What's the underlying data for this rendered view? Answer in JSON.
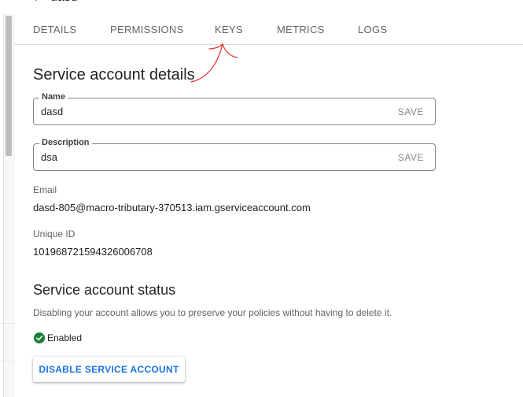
{
  "header": {
    "title": "dasd"
  },
  "tabs": [
    {
      "label": "DETAILS"
    },
    {
      "label": "PERMISSIONS"
    },
    {
      "label": "KEYS"
    },
    {
      "label": "METRICS"
    },
    {
      "label": "LOGS"
    }
  ],
  "details": {
    "heading": "Service account details",
    "name": {
      "label": "Name",
      "value": "dasd",
      "save_label": "SAVE"
    },
    "description": {
      "label": "Description",
      "value": "dsa",
      "save_label": "SAVE"
    },
    "email": {
      "label": "Email",
      "value": "dasd-805@macro-tributary-370513.iam.gserviceaccount.com"
    },
    "unique_id": {
      "label": "Unique ID",
      "value": "101968721594326006708"
    }
  },
  "status": {
    "heading": "Service account status",
    "description": "Disabling your account allows you to preserve your policies without having to delete it.",
    "state_label": "Enabled",
    "state_color": "#188038",
    "disable_button_label": "DISABLE SERVICE ACCOUNT"
  },
  "colors": {
    "accent": "#1a73e8",
    "annotation": "#e53935"
  }
}
